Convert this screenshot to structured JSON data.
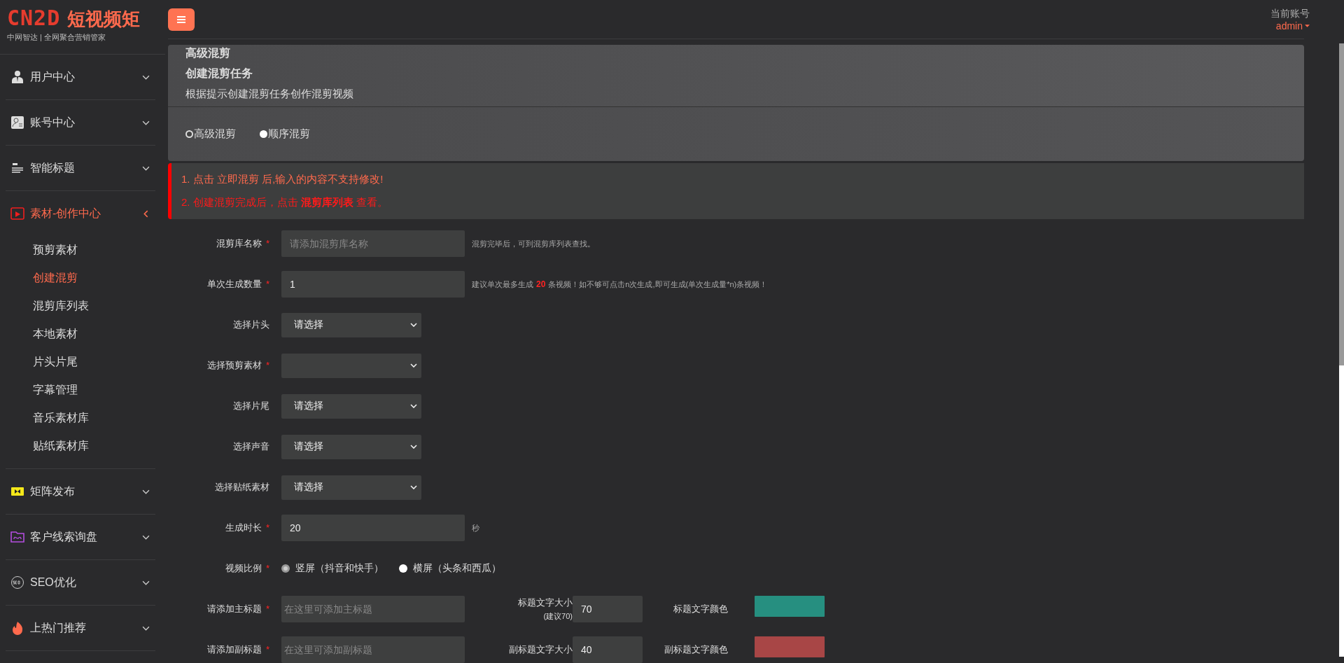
{
  "logo": {
    "mark": "CN2D",
    "name": "短视频矩",
    "tagline": "中网智达 | 全网聚合营销管家"
  },
  "sidebar": {
    "items": [
      {
        "kind": "user",
        "label": "用户中心",
        "expanded": false,
        "selected": false
      },
      {
        "kind": "account",
        "label": "账号中心",
        "expanded": false,
        "selected": false
      },
      {
        "kind": "title",
        "label": "智能标题",
        "expanded": false,
        "selected": false
      },
      {
        "kind": "video",
        "label": "素材-创作中心",
        "expanded": true,
        "selected": true,
        "children": [
          {
            "label": "预剪素材",
            "selected": false
          },
          {
            "label": "创建混剪",
            "selected": true
          },
          {
            "label": "混剪库列表",
            "selected": false
          },
          {
            "label": "本地素材",
            "selected": false
          },
          {
            "label": "片头片尾",
            "selected": false
          },
          {
            "label": "字幕管理",
            "selected": false
          },
          {
            "label": "音乐素材库",
            "selected": false
          },
          {
            "label": "贴纸素材库",
            "selected": false
          }
        ]
      },
      {
        "kind": "publish",
        "label": "矩阵发布",
        "expanded": false,
        "selected": false
      },
      {
        "kind": "folder",
        "label": "客户线索询盘",
        "expanded": false,
        "selected": false
      },
      {
        "kind": "seo",
        "label": "SEO优化",
        "expanded": false,
        "selected": false
      },
      {
        "kind": "fire",
        "label": "上热门推荐",
        "expanded": false,
        "selected": false
      }
    ]
  },
  "account": {
    "label": "当前账号",
    "user": "admin"
  },
  "header": {
    "breadcrumb": "高级混剪",
    "title": "创建混剪任务",
    "subtitle": "根据提示创建混剪任务创作混剪视频"
  },
  "modes": [
    {
      "label": "高级混剪",
      "selected": true
    },
    {
      "label": "顺序混剪",
      "selected": false
    }
  ],
  "notices": [
    {
      "text": "1. 点击 立即混剪 后,输入的内容不支持修改!",
      "color": "#ff6a4d"
    },
    {
      "text": "2. 创建混剪完成后，点击 **混剪库列表** 查看。",
      "color": "#ff1a1a"
    }
  ],
  "required_mark": "*",
  "form": [
    {
      "kind": "text",
      "label": "混剪库名称",
      "required": true,
      "placeholder": "请添加混剪库名称",
      "help": "混剪完毕后，可到混剪库列表查找。"
    },
    {
      "kind": "text",
      "label": "单次生成数量",
      "required": true,
      "value": "1",
      "help_parts": [
        "建议单次最多生成",
        "20",
        "条视频！如不够可点击n次生成,即可生成(单次生成量*n)条视频！"
      ]
    },
    {
      "kind": "select",
      "label": "选择片头",
      "required": false,
      "value": "请选择"
    },
    {
      "kind": "select",
      "label": "选择预剪素材",
      "required": true
    },
    {
      "kind": "select",
      "label": "选择片尾",
      "required": false,
      "value": "请选择"
    },
    {
      "kind": "select",
      "label": "选择声音",
      "required": false,
      "value": "请选择"
    },
    {
      "kind": "select",
      "label": "选择贴纸素材",
      "required": false,
      "value": "请选择"
    },
    {
      "kind": "short",
      "label": "生成时长",
      "required": true,
      "value": "20",
      "unit": "秒"
    },
    {
      "kind": "radio",
      "label": "视频比例",
      "required": true,
      "options": [
        {
          "label": "竖屏（抖音和快手）",
          "selected": true
        },
        {
          "label": "横屏（头条和西瓜）",
          "selected": false
        }
      ]
    },
    {
      "kind": "title",
      "label": "请添加主标题",
      "required": true,
      "placeholder": "在这里可添加主标题",
      "size_label": "标题文字大小",
      "size_hint": "(建议70)",
      "size": "70",
      "color_label": "标题文字颜色",
      "color": "#268f80"
    },
    {
      "kind": "title",
      "label": "请添加副标题",
      "required": true,
      "placeholder": "在这里可添加副标题",
      "size_label": "副标题文字大小",
      "size": "40",
      "color_label": "副标题文字颜色",
      "color": "#a84646"
    }
  ]
}
